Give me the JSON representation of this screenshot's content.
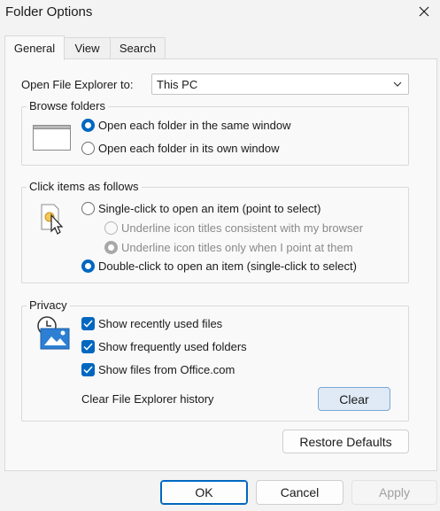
{
  "window": {
    "title": "Folder Options",
    "close_icon": "close-icon"
  },
  "tabs": [
    {
      "label": "General",
      "active": true
    },
    {
      "label": "View",
      "active": false
    },
    {
      "label": "Search",
      "active": false
    }
  ],
  "general": {
    "open_explorer_label": "Open File Explorer to:",
    "open_explorer_value": "This PC",
    "browse_folders": {
      "title": "Browse folders",
      "icon": "window-icon",
      "options": [
        {
          "label": "Open each folder in the same window",
          "selected": true
        },
        {
          "label": "Open each folder in its own window",
          "selected": false
        }
      ]
    },
    "click_items": {
      "title": "Click items as follows",
      "icon": "cursor-click-icon",
      "single_click_label": "Single-click to open an item (point to select)",
      "underline_consistent_label": "Underline icon titles consistent with my browser",
      "underline_point_label": "Underline icon titles only when I point at them",
      "double_click_label": "Double-click to open an item (single-click to select)",
      "selected": "double"
    },
    "privacy": {
      "title": "Privacy",
      "icon": "privacy-icon",
      "checkboxes": [
        {
          "label": "Show recently used files",
          "checked": true
        },
        {
          "label": "Show frequently used folders",
          "checked": true
        },
        {
          "label": "Show files from Office.com",
          "checked": true
        }
      ],
      "clear_history_label": "Clear File Explorer history",
      "clear_button": "Clear"
    },
    "restore_defaults": "Restore Defaults"
  },
  "footer": {
    "ok": "OK",
    "cancel": "Cancel",
    "apply": "Apply"
  },
  "colors": {
    "accent": "#0067c0",
    "background": "#f3f3f3",
    "panel": "#f9f9f9"
  }
}
